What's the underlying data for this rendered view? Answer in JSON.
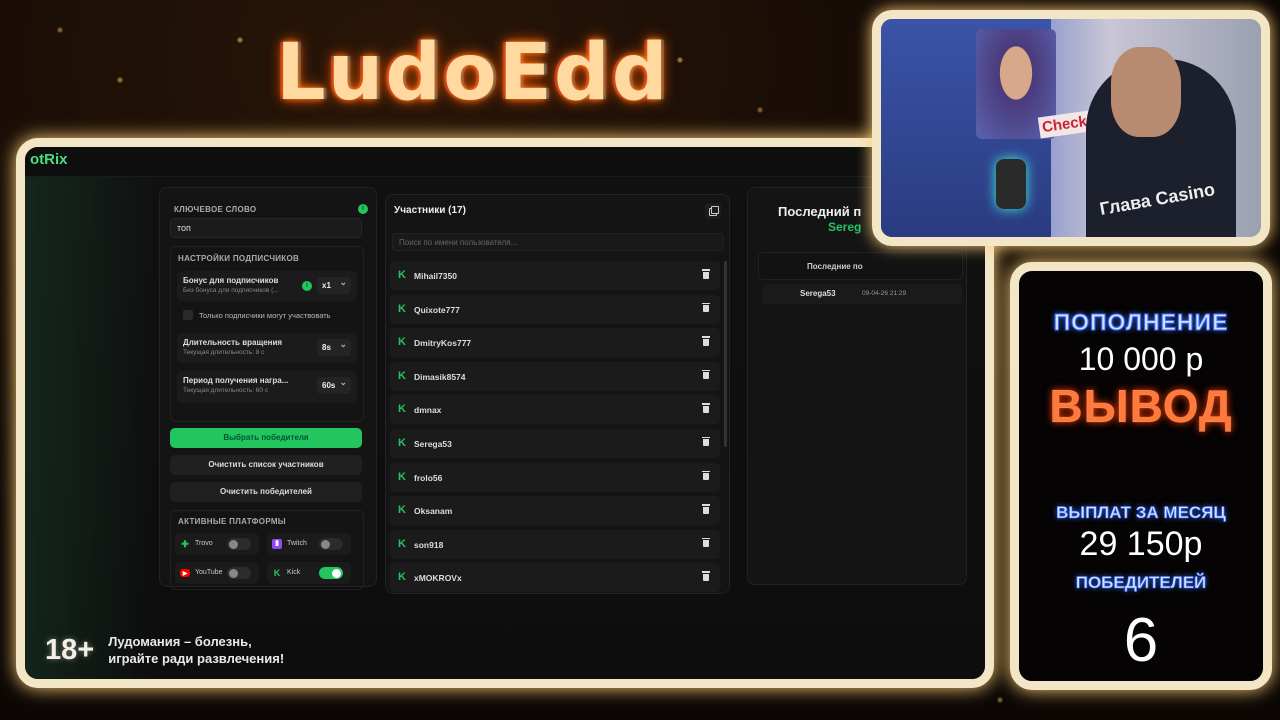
{
  "logo": "LudoEdd",
  "app": {
    "brand": "otRix"
  },
  "keyword": {
    "label": "КЛЮЧЕВОЕ СЛОВО",
    "value": "топ"
  },
  "subscriber_settings": {
    "title": "НАСТРОЙКИ ПОДПИСЧИКОВ",
    "bonus": {
      "label": "Бонус для подписчиков",
      "sub": "Без бонуса для подписчиков (...",
      "value": "x1"
    },
    "only_subs": "Только подписчики могут участвовать",
    "spin": {
      "label": "Длительность вращения",
      "sub": "Текущая длительность: 8 с",
      "value": "8s"
    },
    "reward": {
      "label": "Период получения награ...",
      "sub": "Текущая длительность: 60 с",
      "value": "60s"
    }
  },
  "buttons": {
    "pick_winner": "Выбрать победителя",
    "clear_participants": "Очистить список участников",
    "clear_winners": "Очистить победителей"
  },
  "platforms": {
    "title": "АКТИВНЫЕ ПЛАТФОРМЫ",
    "items": [
      {
        "name": "Trovo",
        "enabled": false,
        "color": "#22c55e"
      },
      {
        "name": "Twitch",
        "enabled": false,
        "color": "#9146ff"
      },
      {
        "name": "YouTube",
        "enabled": false,
        "color": "#ff0000"
      },
      {
        "name": "Kick",
        "enabled": true,
        "color": "#22c55e"
      }
    ]
  },
  "participants": {
    "title": "Участники (17)",
    "search_placeholder": "Поиск по имени пользователя...",
    "items": [
      "Mihail7350",
      "Quixote777",
      "DmitryKos777",
      "Dimasik8574",
      "dmnax",
      "Serega53",
      "frolo56",
      "Oksanam",
      "son918",
      "xMOKROVx"
    ]
  },
  "last_winner": {
    "title": "Последний п",
    "name": "Sereg",
    "tab": "Последние по",
    "rows": [
      {
        "name": "Serega53",
        "date": "09-04-26 21:29"
      }
    ]
  },
  "warning": {
    "age": "18+",
    "line1": "Лудомания – болезнь,",
    "line2": "играйте ради развлечения!"
  },
  "webcam": {
    "sign": "Check",
    "shirt": "Глава Casino"
  },
  "stats": {
    "deposit_label": "ПОПОЛНЕНИЕ",
    "deposit_value": "10 000 р",
    "withdraw_label": "ВЫВОД",
    "payouts_label": "ВЫПЛАТ ЗА МЕСЯЦ",
    "payouts_value": "29 150р",
    "winners_label": "ПОБЕДИТЕЛЕЙ",
    "winners_value": "6"
  },
  "colors": {
    "accent": "#22c55e",
    "frame": "#f3e6c6"
  }
}
